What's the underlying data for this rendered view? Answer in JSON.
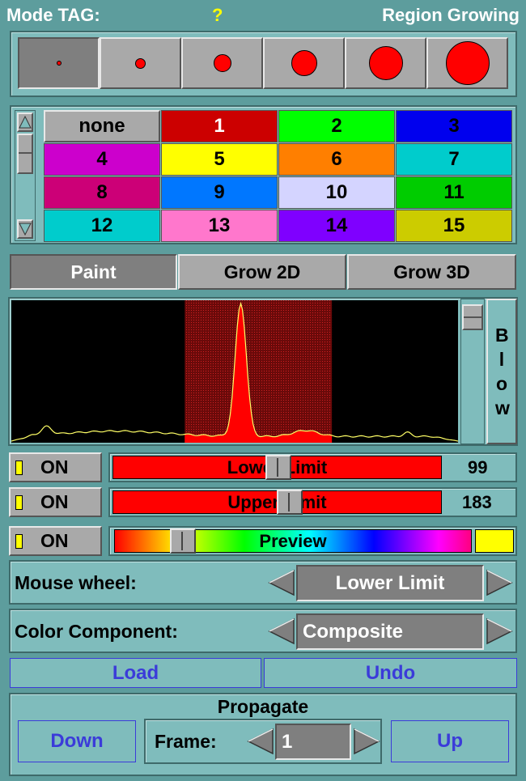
{
  "header": {
    "mode_label": "Mode TAG:",
    "mode_value": "?",
    "title": "Region Growing"
  },
  "brush_sizes": [
    {
      "name": "brush-size-1",
      "selected": true
    },
    {
      "name": "brush-size-2",
      "selected": false
    },
    {
      "name": "brush-size-3",
      "selected": false
    },
    {
      "name": "brush-size-4",
      "selected": false
    },
    {
      "name": "brush-size-5",
      "selected": false
    },
    {
      "name": "brush-size-6",
      "selected": false
    }
  ],
  "tags": [
    {
      "label": "none",
      "color": "#a9a9a9",
      "text": "#000000"
    },
    {
      "label": "1",
      "color": "#cc0000",
      "text": "#ffffff"
    },
    {
      "label": "2",
      "color": "#00ff00",
      "text": "#000000"
    },
    {
      "label": "3",
      "color": "#0000ee",
      "text": "#000000"
    },
    {
      "label": "4",
      "color": "#cc00cc",
      "text": "#000000"
    },
    {
      "label": "5",
      "color": "#ffff00",
      "text": "#000000"
    },
    {
      "label": "6",
      "color": "#ff7f00",
      "text": "#000000"
    },
    {
      "label": "7",
      "color": "#00cccc",
      "text": "#000000"
    },
    {
      "label": "8",
      "color": "#cc0077",
      "text": "#000000"
    },
    {
      "label": "9",
      "color": "#0077ff",
      "text": "#000000"
    },
    {
      "label": "10",
      "color": "#d4d4ff",
      "text": "#000000"
    },
    {
      "label": "11",
      "color": "#00cc00",
      "text": "#000000"
    },
    {
      "label": "12",
      "color": "#00cccc",
      "text": "#000000"
    },
    {
      "label": "13",
      "color": "#ff77cc",
      "text": "#000000"
    },
    {
      "label": "14",
      "color": "#7f00ff",
      "text": "#000000"
    },
    {
      "label": "15",
      "color": "#cccc00",
      "text": "#000000"
    }
  ],
  "modes": {
    "paint": "Paint",
    "grow2d": "Grow 2D",
    "grow3d": "Grow 3D",
    "selected": "paint"
  },
  "histogram": {
    "blow_label": "Blow",
    "lower": 99,
    "upper": 183
  },
  "limits": {
    "lower": {
      "on_label": "ON",
      "label": "Lower Limit",
      "value": "99"
    },
    "upper": {
      "on_label": "ON",
      "label": "Upper Limit",
      "value": "183"
    },
    "preview": {
      "on_label": "ON",
      "label": "Preview",
      "swatch": "#ffff00"
    }
  },
  "mouse_wheel": {
    "label": "Mouse wheel:",
    "value": "Lower Limit"
  },
  "color_component": {
    "label": "Color Component:",
    "value": "Composite"
  },
  "actions": {
    "load": "Load",
    "undo": "Undo"
  },
  "propagate": {
    "title": "Propagate",
    "down": "Down",
    "up": "Up",
    "frame_label": "Frame:",
    "frame_value": "1"
  }
}
